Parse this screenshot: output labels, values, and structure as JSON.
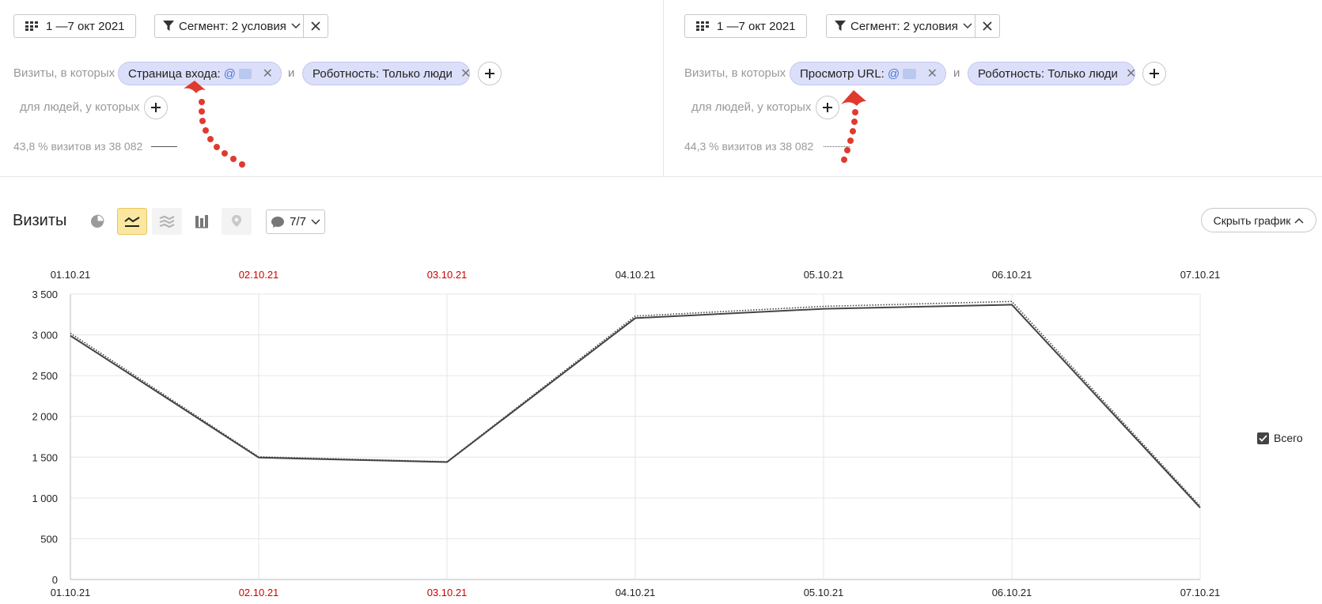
{
  "segments": [
    {
      "date_label": "1 —7 окт 2021",
      "segment_label": "Сегмент: 2 условия",
      "visits_prefix": "Визиты, в которых",
      "chips": [
        {
          "label": "Страница входа:",
          "at": "@"
        },
        {
          "label": "Роботность: Только люди"
        }
      ],
      "and_label": "и",
      "people_label": "для людей, у которых",
      "stat": "43,8 % визитов из 38 082"
    },
    {
      "date_label": "1 —7 окт 2021",
      "segment_label": "Сегмент: 2 условия",
      "visits_prefix": "Визиты, в которых",
      "chips": [
        {
          "label": "Просмотр URL:",
          "at": "@"
        },
        {
          "label": "Роботность: Только люди"
        }
      ],
      "and_label": "и",
      "people_label": "для людей, у которых",
      "stat": "44,3 % визитов из 38 082"
    }
  ],
  "chart_header": {
    "title": "Визиты",
    "comments_label": "7/7",
    "hide_label": "Скрыть график"
  },
  "colors": {
    "weekend": "#cc0000",
    "arrow": "#e03a2f",
    "active_tool": "#fce7a0",
    "chip": "#dcdff9"
  },
  "chart_data": {
    "type": "line",
    "x": [
      "01.10.21",
      "02.10.21",
      "03.10.21",
      "04.10.21",
      "05.10.21",
      "06.10.21",
      "07.10.21"
    ],
    "weekend": [
      false,
      true,
      true,
      false,
      false,
      false,
      false
    ],
    "series": [
      {
        "values": [
          2990,
          1495,
          1440,
          3205,
          3320,
          3370,
          880
        ],
        "style": "solid"
      },
      {
        "values": [
          3020,
          1505,
          1445,
          3230,
          3350,
          3410,
          900
        ],
        "style": "dotted"
      }
    ],
    "ylim": [
      0,
      3500
    ],
    "yticks": [
      0,
      500,
      1000,
      1500,
      2000,
      2500,
      3000,
      3500
    ],
    "ytick_labels": [
      "0",
      "500",
      "1 000",
      "1 500",
      "2 000",
      "2 500",
      "3 000",
      "3 500"
    ],
    "legend": "Всего",
    "legend_position": "right",
    "grid": true
  }
}
